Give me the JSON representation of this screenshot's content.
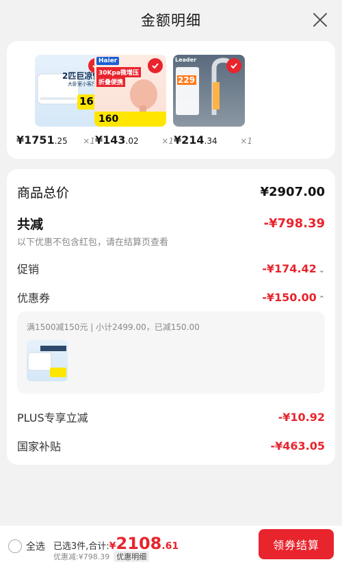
{
  "header": {
    "title": "金额明细"
  },
  "products": [
    {
      "price_int": "¥1751",
      "price_dec": ".25",
      "qty": "×1",
      "thumb_label": "2匹巨凉快大挂",
      "thumb_sub": "大卧室小客厅优选",
      "thumb_price": "1631"
    },
    {
      "price_int": "¥143",
      "price_dec": ".02",
      "qty": "×1",
      "thumb_brand": "Haier",
      "thumb_label": "30Kpa微增压",
      "thumb_sub": "折叠便携",
      "thumb_price": "160"
    },
    {
      "price_int": "¥214",
      "price_dec": ".34",
      "qty": "×1",
      "thumb_brand": "Leader",
      "thumb_price": "229"
    }
  ],
  "summary": {
    "total_label": "商品总价",
    "total_value": "¥2907.00",
    "discount_label": "共减",
    "discount_value": "-¥798.39",
    "discount_note": "以下优惠不包含红包，请在结算页查看",
    "promo_label": "促销",
    "promo_value": "-¥174.42",
    "coupon_label": "优惠券",
    "coupon_value": "-¥150.00",
    "coupon_detail": "满1500减150元 | 小计2499.00，已减150.00",
    "plus_label": "PLUS专享立减",
    "plus_value": "-¥10.92",
    "subsidy_label": "国家补贴",
    "subsidy_value": "-¥463.05"
  },
  "bottom": {
    "select_all": "全选",
    "selected_text": "已选3件,合计:",
    "currency": "¥",
    "total_int": "2108",
    "total_dec": ".61",
    "discount_text": "优惠减:¥798.39",
    "detail_tag": "优惠明细",
    "checkout": "领券结算"
  },
  "colors": {
    "accent": "#e8242d",
    "background": "#f2f2f2"
  }
}
